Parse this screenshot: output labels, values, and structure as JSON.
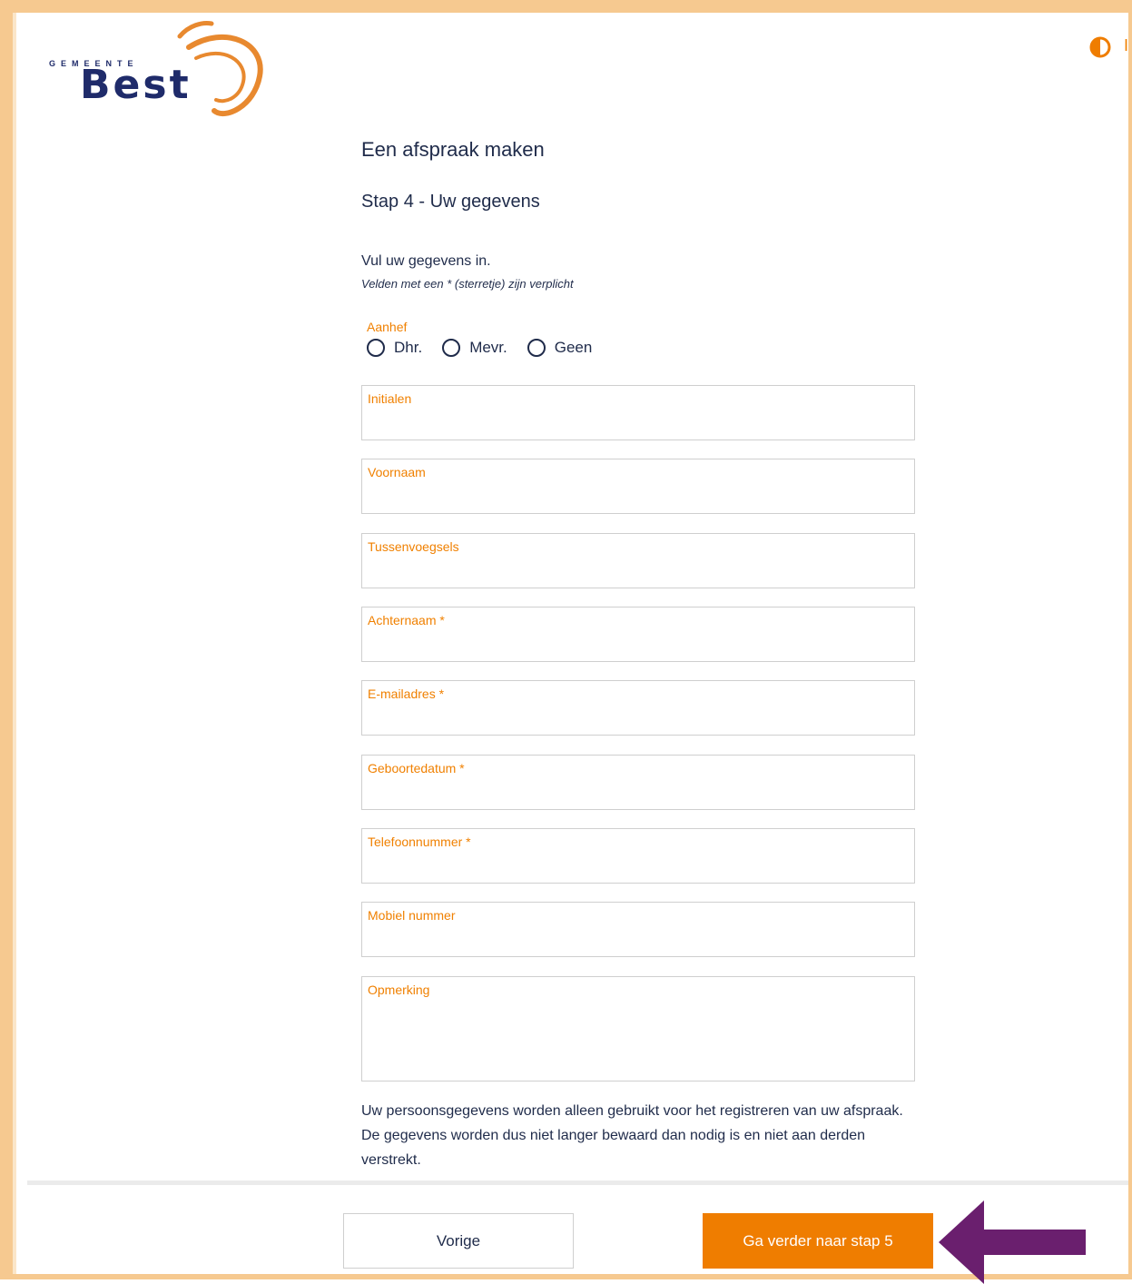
{
  "brand": {
    "municipality_label": "GEMEENTE",
    "name": "Best",
    "logo_navy": "#1f2b6a",
    "logo_orange": "#e8892f"
  },
  "header": {
    "contrast_icon": "contrast-toggle-icon",
    "cut_text": "I"
  },
  "page": {
    "title": "Een afspraak maken",
    "step_title": "Stap 4 - Uw gegevens",
    "intro": "Vul uw gegevens in.",
    "required_note": "Velden met een * (sterretje) zijn verplicht"
  },
  "form": {
    "aanhef": {
      "label": "Aanhef",
      "options": [
        "Dhr.",
        "Mevr.",
        "Geen"
      ]
    },
    "fields": [
      {
        "label": "Initialen",
        "value": ""
      },
      {
        "label": "Voornaam",
        "value": ""
      },
      {
        "label": "Tussenvoegsels",
        "value": ""
      },
      {
        "label": "Achternaam *",
        "value": ""
      },
      {
        "label": "E-mailadres *",
        "value": ""
      },
      {
        "label": "Geboortedatum *",
        "value": ""
      },
      {
        "label": "Telefoonnummer *",
        "value": ""
      },
      {
        "label": "Mobiel nummer",
        "value": ""
      },
      {
        "label": "Opmerking",
        "value": ""
      }
    ]
  },
  "privacy_text": "Uw persoonsgegevens worden alleen gebruikt voor het registreren van uw afspraak. De gegevens worden dus niet langer bewaard dan nodig is en niet aan derden verstrekt.",
  "actions": {
    "previous_label": "Vorige",
    "next_label": "Ga verder naar stap 5"
  },
  "colors": {
    "accent": "#ef7d00",
    "text": "#1f2b4a",
    "frame": "#f6c990",
    "annotation_arrow": "#6a1f6e"
  }
}
